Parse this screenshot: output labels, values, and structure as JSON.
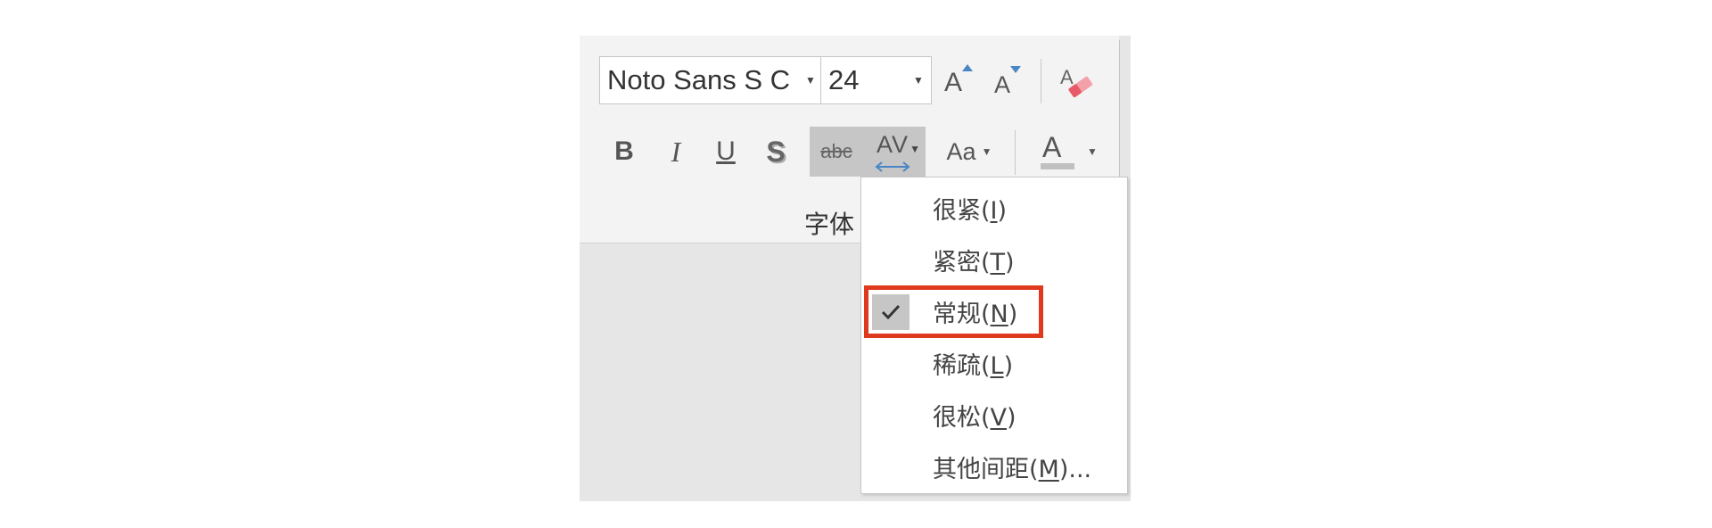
{
  "ribbon": {
    "font_name": "Noto Sans S C",
    "font_size": "24",
    "bold_label": "B",
    "italic_label": "I",
    "underline_label": "U",
    "shadow_label": "S",
    "strike_label": "abc",
    "spacing_label": "AV",
    "change_case_label": "Aa",
    "font_color_label": "A",
    "grow_font_label": "A",
    "shrink_font_label": "A",
    "group_label": "字体"
  },
  "spacing_menu": {
    "items": [
      {
        "text": "很紧(",
        "key": "I",
        "suffix": ")"
      },
      {
        "text": "紧密(",
        "key": "T",
        "suffix": ")"
      },
      {
        "text": "常规(",
        "key": "N",
        "suffix": ")"
      },
      {
        "text": "稀疏(",
        "key": "L",
        "suffix": ")"
      },
      {
        "text": "很松(",
        "key": "V",
        "suffix": ")"
      },
      {
        "text": "其他间距(",
        "key": "M",
        "suffix": ")..."
      }
    ],
    "checked_index": 2
  },
  "colors": {
    "highlight": "#e03a1e",
    "selected_bg": "#c6c6c6",
    "spacing_arrow": "#4a86c5"
  }
}
